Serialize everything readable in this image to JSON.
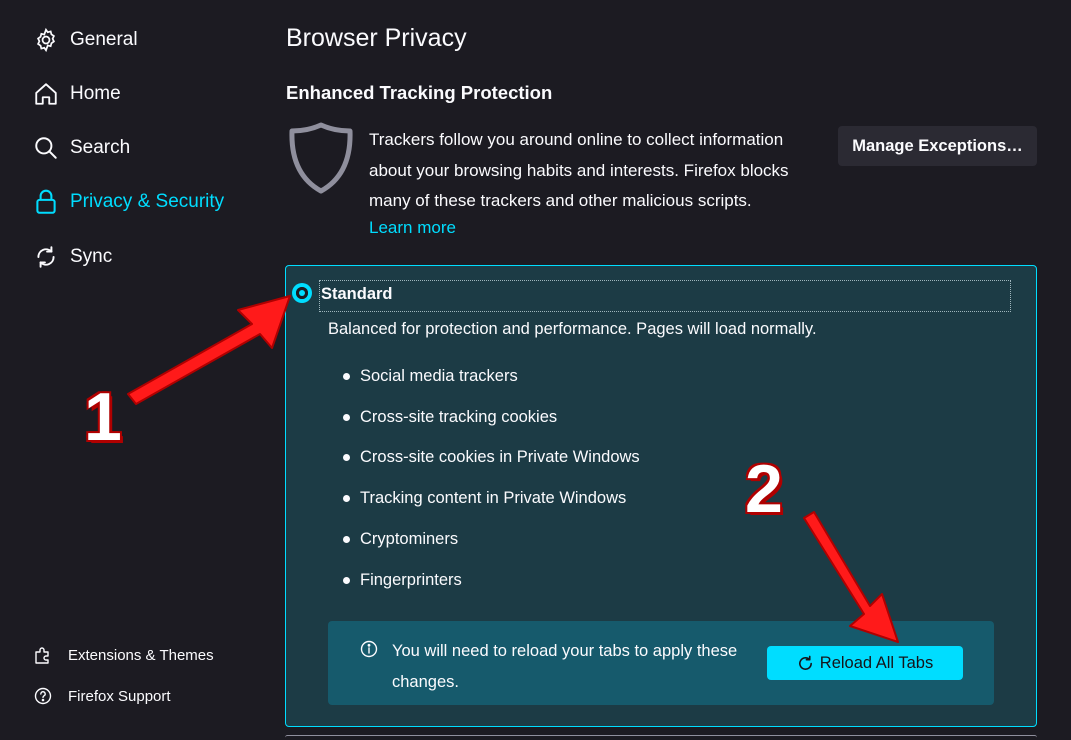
{
  "sidebar": {
    "items": [
      {
        "label": "General",
        "icon": "gear-icon"
      },
      {
        "label": "Home",
        "icon": "home-icon"
      },
      {
        "label": "Search",
        "icon": "search-icon"
      },
      {
        "label": "Privacy & Security",
        "icon": "lock-icon",
        "active": true
      },
      {
        "label": "Sync",
        "icon": "sync-icon"
      }
    ],
    "footer": [
      {
        "label": "Extensions & Themes",
        "icon": "puzzle-icon"
      },
      {
        "label": "Firefox Support",
        "icon": "help-icon"
      }
    ]
  },
  "main": {
    "page_title": "Browser Privacy",
    "section_title": "Enhanced Tracking Protection",
    "description": "Trackers follow you around online to collect information about your browsing habits and interests. Firefox blocks many of these trackers and other malicious scripts.",
    "learn_more": "Learn more",
    "manage_exceptions": "Manage Exceptions…",
    "standard": {
      "label": "Standard",
      "selected": true,
      "description": "Balanced for protection and performance. Pages will load normally.",
      "items": [
        "Social media trackers",
        "Cross-site tracking cookies",
        "Cross-site cookies in Private Windows",
        "Tracking content in Private Windows",
        "Cryptominers",
        "Fingerprinters"
      ]
    },
    "notice": {
      "text": "You will need to reload your tabs to apply these changes.",
      "button": "Reload All Tabs"
    }
  },
  "annotations": {
    "first": "1",
    "second": "2",
    "color": "#ff1a1a"
  },
  "colors": {
    "background": "#1c1b22",
    "accent": "#00ddff",
    "card": "#1c3b45",
    "notice": "#165a6c",
    "button": "#2b2a33"
  }
}
